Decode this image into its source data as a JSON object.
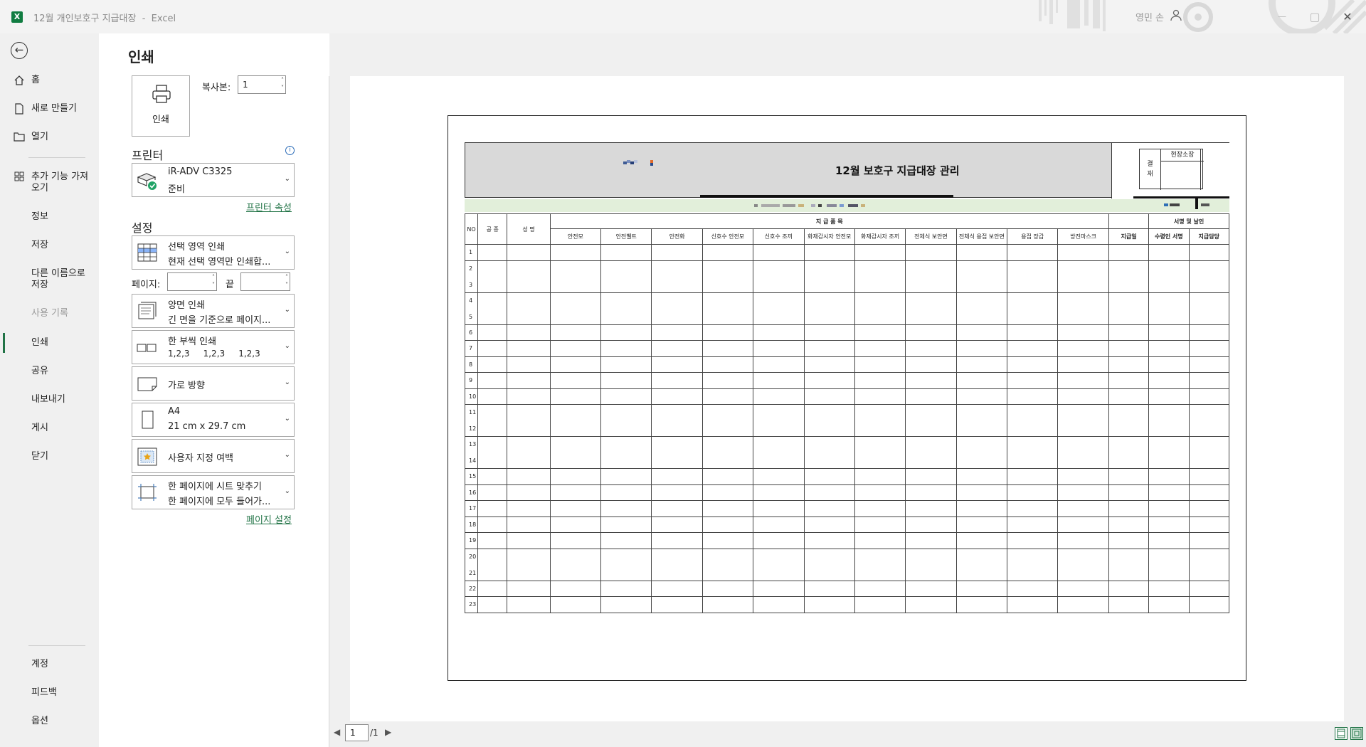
{
  "window": {
    "title": "12월 개인보호구 지급대장",
    "app": "Excel",
    "user_name": "영민 손",
    "minimize": "—",
    "restore": "▢",
    "close": "✕"
  },
  "nav": {
    "back_label": "←",
    "items": [
      {
        "label": "홈",
        "icon": "home-icon"
      },
      {
        "label": "새로 만들기",
        "icon": "new-doc-icon"
      },
      {
        "label": "열기",
        "icon": "folder-icon"
      },
      {
        "label": "추가 기능 가져오기",
        "icon": "addins-icon"
      },
      {
        "label": "정보"
      },
      {
        "label": "저장"
      },
      {
        "label": "다른 이름으로 저장"
      },
      {
        "label": "사용 기록"
      },
      {
        "label": "인쇄"
      },
      {
        "label": "공유"
      },
      {
        "label": "내보내기"
      },
      {
        "label": "게시"
      },
      {
        "label": "닫기"
      }
    ],
    "bottom": [
      {
        "label": "계정"
      },
      {
        "label": "피드백"
      },
      {
        "label": "옵션"
      }
    ]
  },
  "print": {
    "title": "인쇄",
    "print_button": "인쇄",
    "copies_label": "복사본:",
    "copies_value": "1",
    "printer_section": "프린터",
    "printer_name": "iR-ADV C3325",
    "printer_status": "준비",
    "printer_props_link": "프린터 속성",
    "settings_section": "설정",
    "settings": {
      "what": {
        "title": "선택 영역 인쇄",
        "desc": "현재 선택 영역만 인쇄합..."
      },
      "pages_label": "페이지:",
      "pages_to": "끝",
      "duplex": {
        "title": "양면 인쇄",
        "desc": "긴 면을 기준으로 페이지..."
      },
      "collate": {
        "title": "한 부씩 인쇄",
        "desc": "1,2,3     1,2,3     1,2,3"
      },
      "orientation": {
        "title": "가로 방향"
      },
      "paper": {
        "title": "A4",
        "desc": "21 cm x 29.7 cm"
      },
      "margins": {
        "title": "사용자 지정 여백"
      },
      "scaling": {
        "title": "한 페이지에 시트 맞추기",
        "desc": "한 페이지에 모두 들어가..."
      }
    },
    "page_setup_link": "페이지 설정"
  },
  "preview": {
    "sheet_title": "12월 보호구 지급대장 관리",
    "approval": {
      "label_top": "결",
      "label_bottom": "재",
      "head": "현장소장"
    },
    "headers": {
      "no": "NO",
      "trade": "공 종",
      "name": "성 명",
      "items_group": "지 급 품 목",
      "sign_group": "서명 및 날인",
      "items": [
        "안전모",
        "안전벨트",
        "안전화",
        "신호수 안전모",
        "신호수 조끼",
        "화재감시자 안전모",
        "화재감시자 조끼",
        "전체식 보안면",
        "전체식 용접 보안면",
        "용접 장갑",
        "방진마스크"
      ],
      "date": "지급일",
      "receiver": "수령인 서명",
      "giver": "지급담당"
    },
    "rows": [
      {
        "nums": [
          "1"
        ]
      },
      {
        "nums": [
          "2",
          "3"
        ]
      },
      {
        "nums": [
          "4",
          "5"
        ]
      },
      {
        "nums": [
          "6"
        ]
      },
      {
        "nums": [
          "7"
        ]
      },
      {
        "nums": [
          "8"
        ]
      },
      {
        "nums": [
          "9"
        ]
      },
      {
        "nums": [
          "10"
        ]
      },
      {
        "nums": [
          "11",
          "12"
        ]
      },
      {
        "nums": [
          "13",
          "14"
        ]
      },
      {
        "nums": [
          "15"
        ]
      },
      {
        "nums": [
          "16"
        ]
      },
      {
        "nums": [
          "17"
        ]
      },
      {
        "nums": [
          "18"
        ]
      },
      {
        "nums": [
          "19"
        ]
      },
      {
        "nums": [
          "20",
          "21"
        ]
      },
      {
        "nums": [
          "22"
        ]
      },
      {
        "nums": [
          "23"
        ]
      }
    ],
    "current_page": "1",
    "total_pages": "/1"
  },
  "colors": {
    "accent": "#217346",
    "header_gray": "#d9d9d9",
    "band_green": "#e2efda"
  }
}
